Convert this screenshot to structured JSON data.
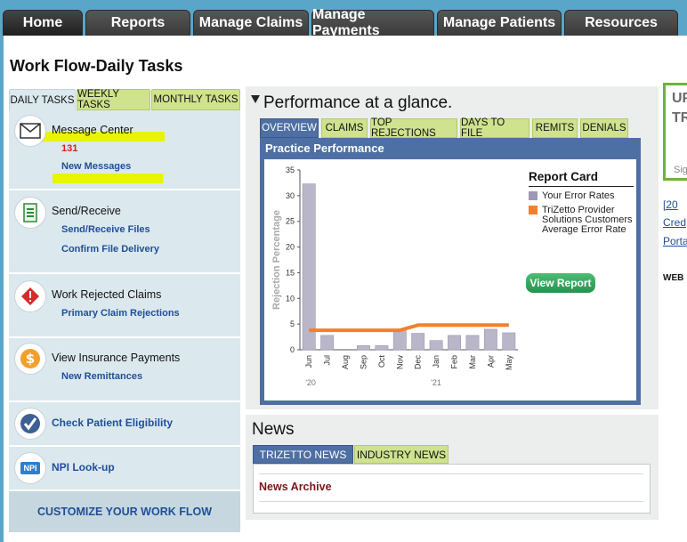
{
  "nav": {
    "tabs": [
      {
        "label": "Home"
      },
      {
        "label": "Reports"
      },
      {
        "label": "Manage Claims"
      },
      {
        "label": "Manage Payments"
      },
      {
        "label": "Manage Patients"
      },
      {
        "label": "Resources"
      }
    ],
    "active": "Home"
  },
  "page": {
    "title": "Work Flow-Daily Tasks"
  },
  "tasks": {
    "tabs": [
      "DAILY TASKS",
      "WEEKLY TASKS",
      "MONTHLY TASKS"
    ],
    "message_center": {
      "title": "Message Center",
      "count": "131",
      "link": "New Messages"
    },
    "send_receive": {
      "title": "Send/Receive",
      "links": [
        "Send/Receive Files",
        "Confirm File Delivery"
      ]
    },
    "rejected": {
      "title": "Work Rejected Claims",
      "link": "Primary Claim Rejections"
    },
    "insurance": {
      "title": "View Insurance Payments",
      "link": "New Remittances"
    },
    "eligibility": {
      "title": "Check Patient Eligibility"
    },
    "npi": {
      "title": "NPI Look-up",
      "icon_text": "NPI"
    },
    "customize": "CUSTOMIZE YOUR WORK FLOW"
  },
  "performance": {
    "title": "Performance at a glance.",
    "tabs": [
      "OVERVIEW",
      "CLAIMS",
      "TOP REJECTIONS",
      "DAYS TO FILE",
      "REMITS",
      "DENIALS"
    ],
    "panel_title": "Practice Performance",
    "report_card": {
      "title": "Report Card",
      "legend": [
        {
          "label": "Your Error Rates",
          "color": "#9e98b5"
        },
        {
          "label": "TriZetto Provider Solutions Customers Average Error Rate",
          "color": "#f08030"
        }
      ]
    },
    "view_report": "View Report"
  },
  "chart_data": {
    "type": "bar",
    "categories": [
      "Jun",
      "Jul",
      "Aug",
      "Sep",
      "Oct",
      "Nov",
      "Dec",
      "Jan",
      "Feb",
      "Mar",
      "Apr",
      "May"
    ],
    "year_labels": [
      "'20",
      "'21"
    ],
    "ylabel": "Rejection Percentage",
    "ylim": [
      0,
      35
    ],
    "yticks": [
      0,
      5,
      10,
      15,
      20,
      25,
      30,
      35
    ],
    "series": [
      {
        "name": "Your Error Rates",
        "type": "bar",
        "values": [
          32.3,
          2.8,
          0,
          0.8,
          0.8,
          4,
          3.2,
          1.8,
          2.8,
          2.8,
          4,
          3.3
        ]
      },
      {
        "name": "TriZetto Provider Solutions Customers Average Error Rate",
        "type": "line",
        "values": [
          3.8,
          3.8,
          3.8,
          3.8,
          3.8,
          3.8,
          4.8,
          4.8,
          4.8,
          4.8,
          4.8,
          4.8
        ]
      }
    ],
    "colors": {
      "bar": "#b9b6ca",
      "line": "#f08030"
    }
  },
  "news": {
    "title": "News",
    "tabs": [
      "TRIZETTO NEWS",
      "INDUSTRY NEWS"
    ],
    "archive": "News Archive"
  },
  "right": {
    "promo": {
      "line1": "UP",
      "line2": "TR",
      "line3": "Sig"
    },
    "links": [
      "[20",
      "Cred",
      "Porta"
    ],
    "web": "WEB"
  }
}
